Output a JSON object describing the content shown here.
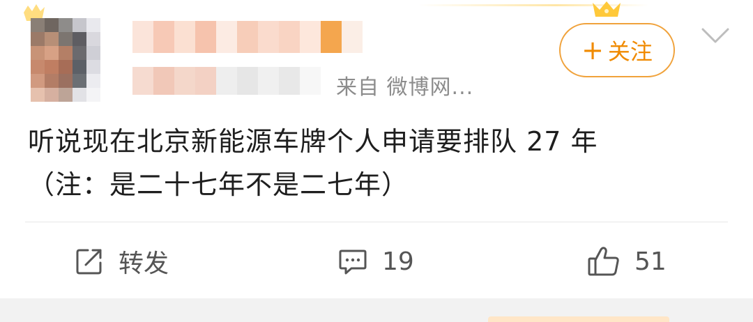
{
  "header": {
    "source_label": "来自 微博网...",
    "follow_button": {
      "plus": "+",
      "label": "关注"
    },
    "menu_icon": "chevron-down-icon"
  },
  "post": {
    "line1": "听说现在北京新能源车牌个人申请要排队 27 年",
    "line2": "（注：是二十七年不是二七年）"
  },
  "actions": {
    "repost": {
      "icon": "share-icon",
      "label": "转发"
    },
    "comment": {
      "icon": "comment-icon",
      "count": "19"
    },
    "like": {
      "icon": "thumbs-up-icon",
      "count": "51"
    }
  },
  "colors": {
    "accent": "#f08a00",
    "follow_border": "#f0a23b",
    "text": "#1e1e1e",
    "secondary_text": "#8c8c8c",
    "action_text": "#555555",
    "divider": "#e6e6e6"
  }
}
